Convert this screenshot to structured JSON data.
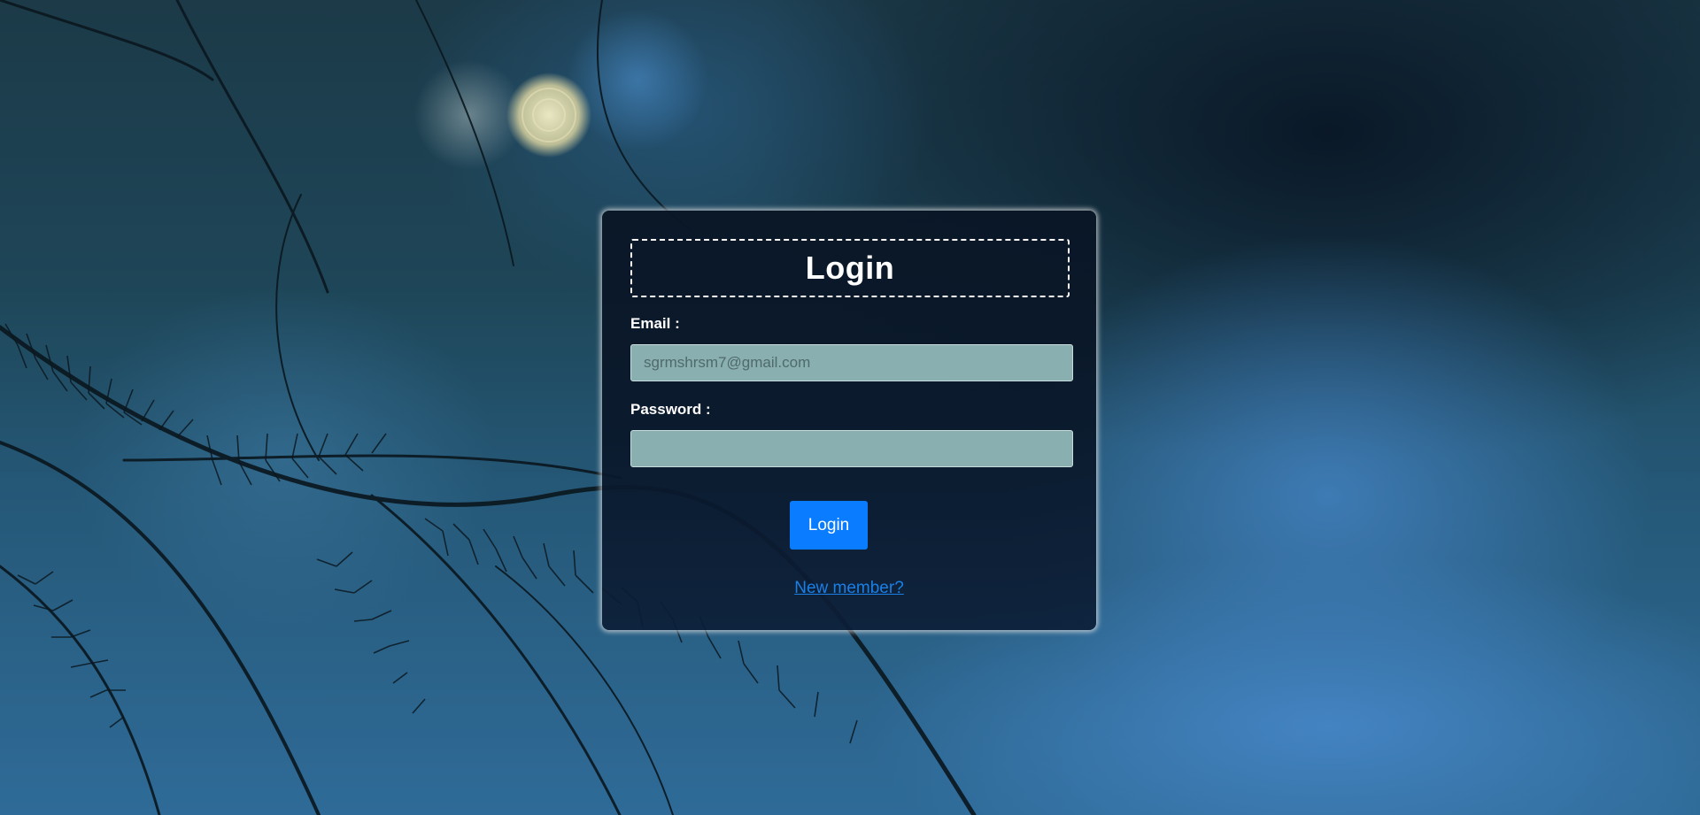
{
  "page": {
    "background_colors": {
      "base": "#255877",
      "highlight": "#4280be",
      "branch": "#0b1820"
    }
  },
  "login_form": {
    "title": "Login",
    "email_label": "Email :",
    "email_placeholder": "sgrmshrsm7@gmail.com",
    "email_value": "",
    "password_label": "Password :",
    "password_value": "",
    "submit_label": "Login",
    "signup_link": "New member?",
    "colors": {
      "card": "#0a1626",
      "input": "#8aafb1",
      "button": "#0a7cff",
      "link": "#1a7fe6"
    }
  }
}
